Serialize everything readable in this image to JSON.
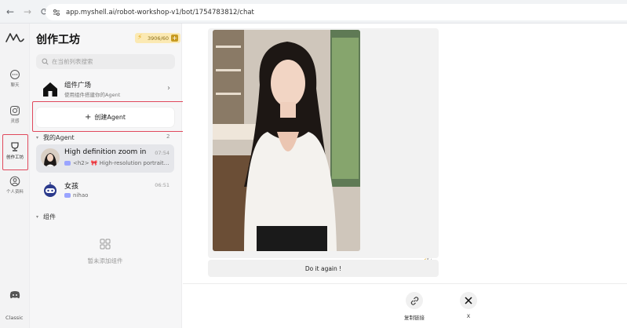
{
  "browser": {
    "url": "app.myshell.ai/robot-workshop-v1/bot/1754783812/chat"
  },
  "rail": {
    "items": [
      {
        "label": "聊天"
      },
      {
        "label": "灵感"
      },
      {
        "label": "创作工坊"
      },
      {
        "label": "个人资料"
      }
    ],
    "bottom_label": "Classic"
  },
  "panel": {
    "title": "创作工坊",
    "credits": "3906/60",
    "search_placeholder": "在当前列表搜索",
    "market": {
      "title": "组件广场",
      "subtitle": "使用组件搭建你的Agent"
    },
    "create_button": "创建Agent",
    "my_agents_label": "我的Agent",
    "my_agents_count": "2",
    "agents": [
      {
        "name": "High definition zoom in",
        "time": "07:54",
        "desc": "<h2> 🎀 High-resolution portrait…"
      },
      {
        "name": "女孩",
        "time": "06:51",
        "desc": "nihao"
      }
    ],
    "components_label": "组件",
    "components_empty": "暂未添加组件"
  },
  "main": {
    "credits_tag": "5+",
    "again_button": "Do it again !",
    "share": [
      {
        "label": "复制链接",
        "icon": "link-icon"
      },
      {
        "label": "X",
        "icon": "x-logo-icon"
      }
    ]
  },
  "colors": {
    "highlight": "#e0485c",
    "credit_badge": "#fbe9b3"
  }
}
